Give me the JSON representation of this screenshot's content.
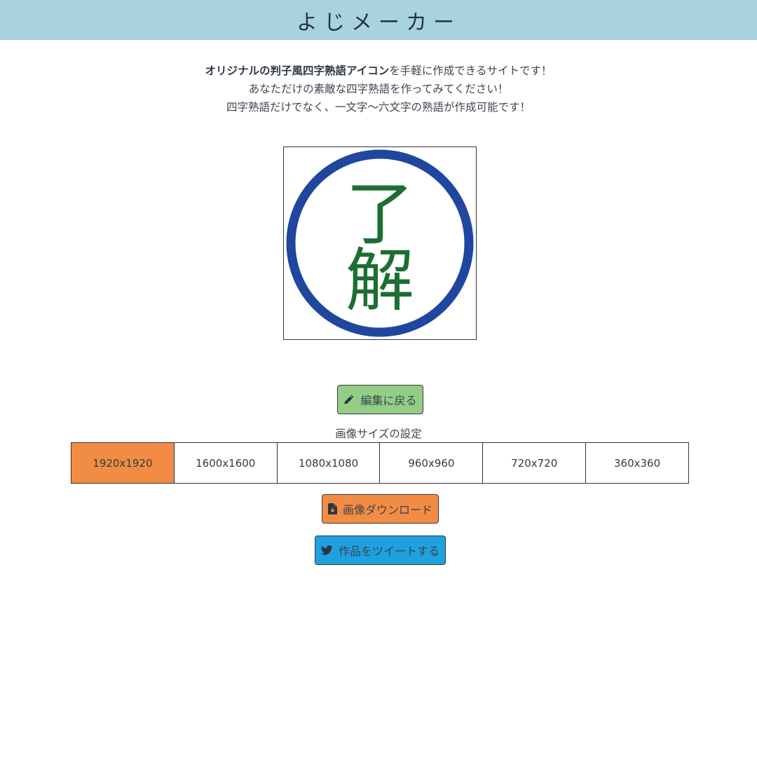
{
  "header": {
    "title": "よじメーカー"
  },
  "intro": {
    "line1_bold": "オリジナルの判子風四字熟語アイコン",
    "line1_rest": "を手軽に作成できるサイトです！",
    "line2": "あなただけの素敵な四字熟語を作ってみてください！",
    "line3": "四字熟語だけでなく、一文字〜六文字の熟語が作成可能です！"
  },
  "preview": {
    "char1": "了",
    "char2": "解",
    "ring_color": "#1f47a0",
    "text_color": "#1c6e33"
  },
  "buttons": {
    "edit_label": "編集に戻る",
    "download_label": "画像ダウンロード",
    "tweet_label": "作品をツイートする",
    "edit_icon": "pencil-icon",
    "download_icon": "file-download-icon",
    "tweet_icon": "twitter-bird-icon"
  },
  "size_settings": {
    "label": "画像サイズの設定",
    "options": [
      "1920x1920",
      "1600x1600",
      "1080x1080",
      "960x960",
      "720x720",
      "360x360"
    ],
    "selected": "1920x1920"
  },
  "colors": {
    "header_bg": "#a9d2e0",
    "edit_button": "#93cd86",
    "download_button": "#f28c44",
    "tweet_button": "#1fa1df",
    "selected_size": "#f28c44"
  }
}
